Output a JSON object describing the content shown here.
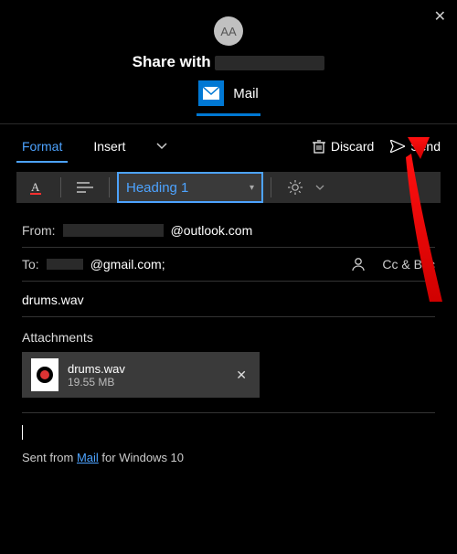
{
  "window": {
    "close": "✕",
    "avatar_initials": "AA",
    "share_prefix": "Share with ",
    "app_icon": "mail-icon",
    "app_label": "Mail"
  },
  "tabs": {
    "format": "Format",
    "insert": "Insert"
  },
  "toolbar": {
    "discard": "Discard",
    "send": "Send",
    "heading": "Heading 1"
  },
  "fields": {
    "from_label": "From:",
    "from_domain": "@outlook.com",
    "to_label": "To:",
    "to_domain": "@gmail.com;",
    "ccbcc": "Cc & Bcc",
    "subject": "drums.wav",
    "attachments_label": "Attachments"
  },
  "attachment": {
    "name": "drums.wav",
    "size": "19.55 MB"
  },
  "signature": {
    "pre": "Sent from ",
    "link": "Mail",
    "post": " for Windows 10"
  }
}
